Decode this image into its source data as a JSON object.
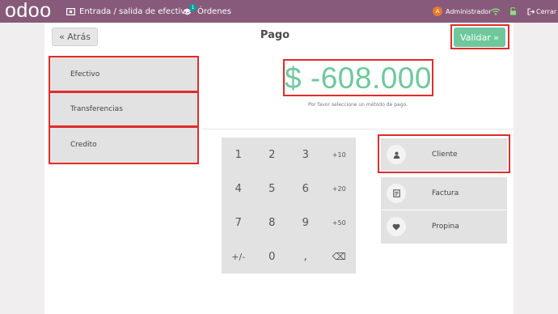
{
  "topbar": {
    "logo": "odoo",
    "cash_label": "Entrada / salida de efectivo",
    "orders_label": "Órdenes",
    "orders_count": "1",
    "user_initial": "A",
    "user_name": "Administrador",
    "close_label": "Cerrar",
    "bg_color": "#875a7b"
  },
  "header": {
    "back_label": "« Atrás",
    "title": "Pago",
    "validate_label": "Validar »"
  },
  "payment_methods": [
    {
      "label": "Efectivo"
    },
    {
      "label": "Transferencias"
    },
    {
      "label": "Credito"
    }
  ],
  "amount": "$ -608.000",
  "hint": "Por favor seleccione un método de pago.",
  "numpad": [
    "1",
    "2",
    "3",
    "+10",
    "4",
    "5",
    "6",
    "+20",
    "7",
    "8",
    "9",
    "+50",
    "+/-",
    "0",
    ",",
    "⌫"
  ],
  "side_buttons": {
    "customer": {
      "label": "Cliente",
      "icon": "user-icon"
    },
    "invoice": {
      "label": "Factura",
      "icon": "invoice-icon"
    },
    "tip": {
      "label": "Propina",
      "icon": "heart-icon"
    }
  },
  "colors": {
    "accent_green": "#6ec89b",
    "highlight_red": "#e02c2c"
  }
}
